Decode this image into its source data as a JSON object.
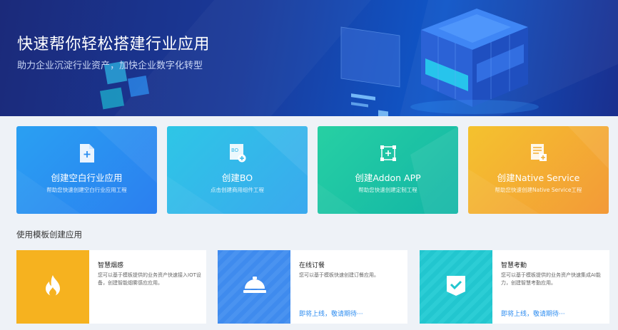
{
  "hero": {
    "title": "快速帮你轻松搭建行业应用",
    "subtitle": "助力企业沉淀行业资产，加快企业数字化转型"
  },
  "actions": [
    {
      "title": "创建空白行业应用",
      "desc": "帮助您快速创建空白行业应用工程",
      "icon": "blank-doc-icon",
      "color": "#2b8ef1"
    },
    {
      "title": "创建BO",
      "desc": "点击创建商用组件工程",
      "icon": "bo-icon",
      "icon_text": "BO",
      "color": "#33b8ea"
    },
    {
      "title": "创建Addon APP",
      "desc": "帮助您快速创建定制工程",
      "icon": "addon-frame-icon",
      "color": "#1fc3a5"
    },
    {
      "title": "创建Native Service",
      "desc": "帮助您快速创建Native Service工程",
      "icon": "native-doc-icon",
      "color": "#f3ae33"
    }
  ],
  "templates_section": {
    "title": "使用模板创建应用",
    "cards": [
      {
        "name": "智慧烟感",
        "desc": "您可以基于模板提供的业务资产快速接入IOT设备，创建智能烟雾感应应用。",
        "link": "",
        "icon": "flame-icon",
        "color": "#f6b21f"
      },
      {
        "name": "在线订餐",
        "desc": "您可以基于模板快速创建订餐应用。",
        "link": "即将上线，敬请期待···",
        "icon": "dish-cover-icon",
        "color": "#3f8bee"
      },
      {
        "name": "智慧考勤",
        "desc": "您可以基于模板提供的业务资产快速集成AI能力，创建智慧考勤应用。",
        "link": "即将上线，敬请期待···",
        "icon": "check-badge-icon",
        "color": "#22c6cf"
      }
    ]
  }
}
